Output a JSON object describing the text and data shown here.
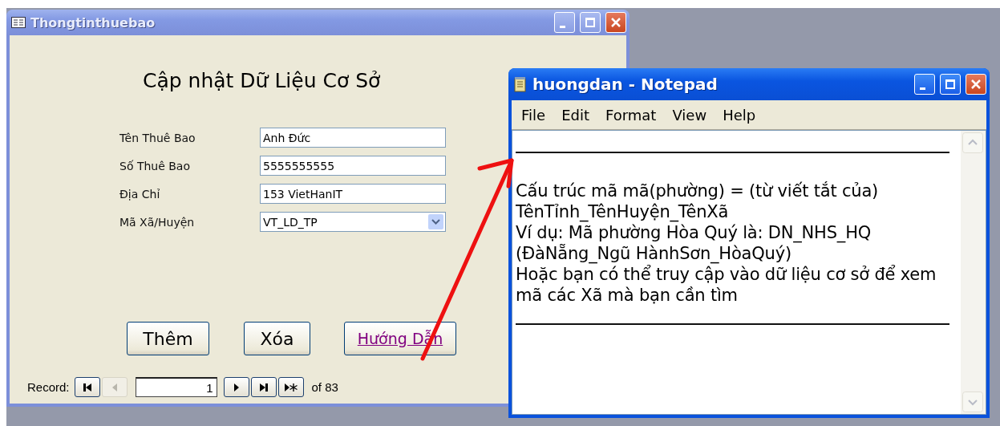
{
  "form_window": {
    "title": "Thongtinthuebao",
    "active": false,
    "heading": "Cập nhật Dữ Liệu Cơ Sở",
    "fields": [
      {
        "label": "Tên Thuê Bao",
        "value": "Anh Đức",
        "kind": "text"
      },
      {
        "label": "Số Thuê Bao",
        "value": "5555555555",
        "kind": "text"
      },
      {
        "label": "Địa Chỉ",
        "value": "153 VietHanIT",
        "kind": "text"
      },
      {
        "label": "Mã Xã/Huyện",
        "value": "VT_LD_TP",
        "kind": "combo"
      }
    ],
    "buttons": [
      {
        "label": "Thêm",
        "kind": "button"
      },
      {
        "label": "Xóa",
        "kind": "button"
      },
      {
        "label": "Hướng Dẫn",
        "kind": "link"
      }
    ],
    "record_nav": {
      "label": "Record:",
      "total": "of 83",
      "items": [
        {
          "kind": "first",
          "disabled": false
        },
        {
          "kind": "prev",
          "disabled": true
        },
        {
          "kind": "field",
          "value": "1"
        },
        {
          "kind": "next",
          "disabled": false
        },
        {
          "kind": "last",
          "disabled": false
        },
        {
          "kind": "new",
          "disabled": false
        }
      ]
    }
  },
  "notepad": {
    "title": "huongdan - Notepad",
    "active": true,
    "menu": [
      "File",
      "Edit",
      "Format",
      "View",
      "Help"
    ],
    "lines": [
      "Cấu trúc mã mã(phường) = (từ viết tắt của)",
      "TênTỉnh_TênHuyện_TênXã",
      "Ví dụ: Mã phường Hòa Quý là: DN_NHS_HQ",
      "(ĐàNẵng_Ngũ HànhSơn_HòaQuý)",
      "Hoặc bạn có thể truy cập vào dữ liệu cơ sở để xem",
      "mã các Xã mà bạn cần tìm"
    ]
  }
}
